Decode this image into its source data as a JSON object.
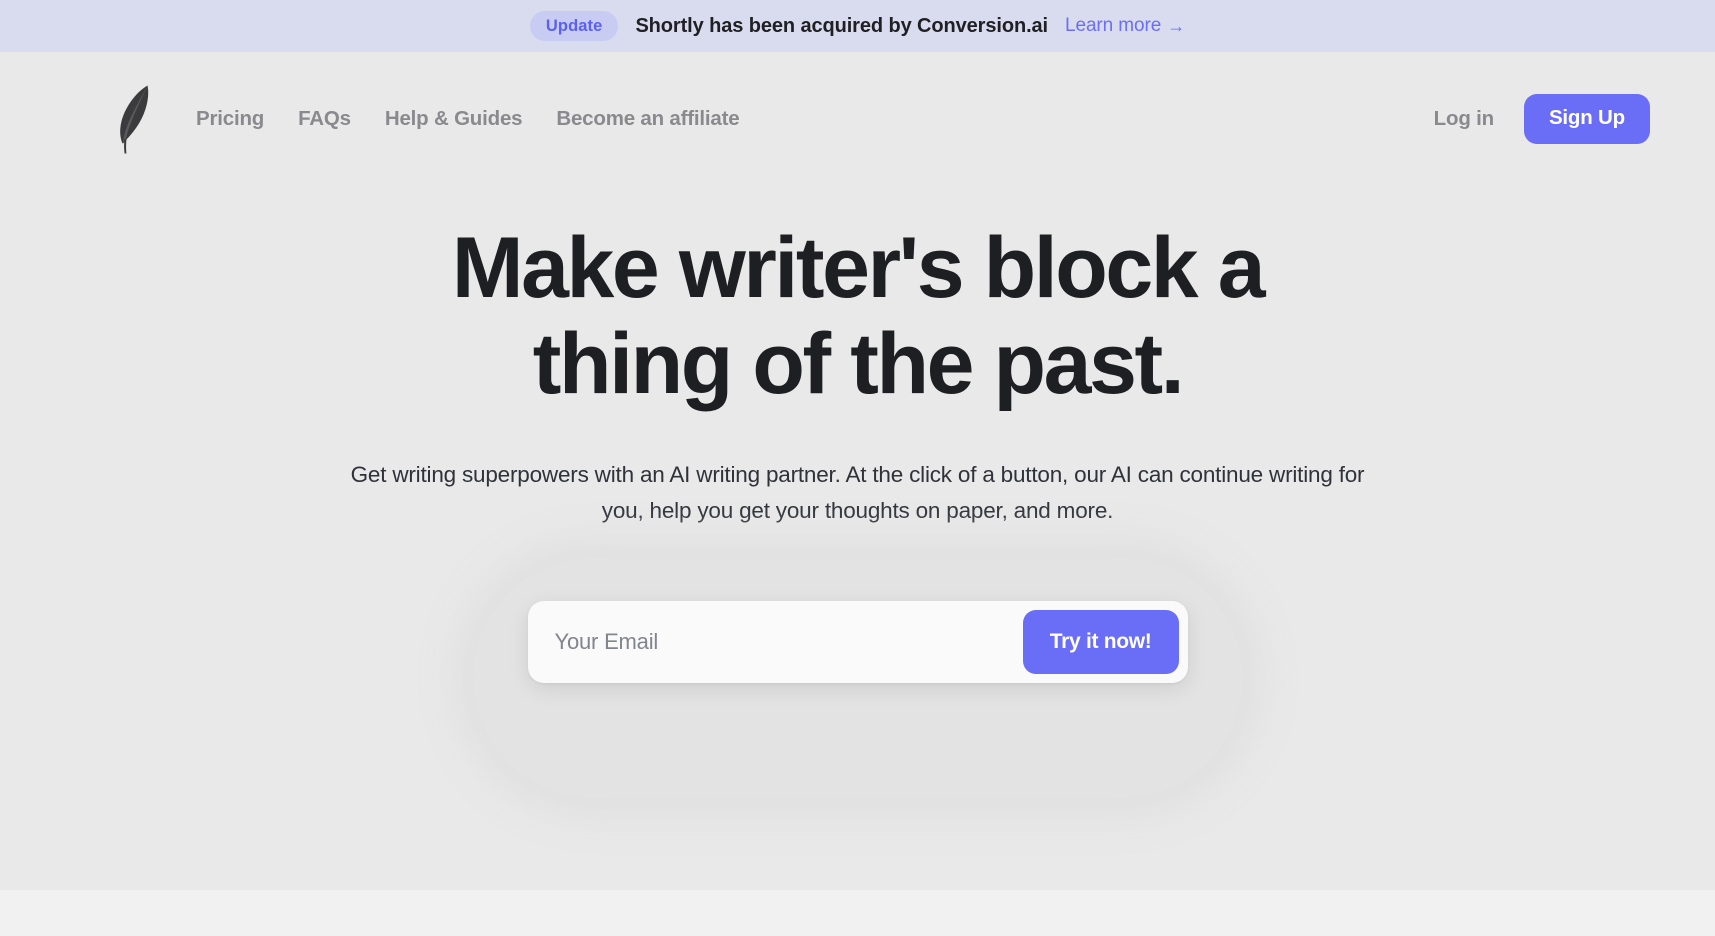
{
  "announcement": {
    "badge_label": "Update",
    "message": "Shortly has been acquired by Conversion.ai",
    "link_label": "Learn more",
    "link_arrow": "→",
    "badge_bg": "#c9ccf2",
    "badge_color": "#5b60f0",
    "bar_bg": "#d9dbee",
    "link_color": "#6b6ef6"
  },
  "nav": {
    "logo_name": "feather-quill-logo",
    "links": [
      {
        "label": "Pricing"
      },
      {
        "label": "FAQs"
      },
      {
        "label": "Help & Guides"
      },
      {
        "label": "Become an affiliate"
      }
    ],
    "login_label": "Log in",
    "signup_label": "Sign Up",
    "accent_color": "#6a6df5",
    "link_color": "#8a8a8e"
  },
  "hero": {
    "headline_line_1": "Make writer's block a",
    "headline_line_2": "thing of the past.",
    "subheadline": "Get writing superpowers with an AI writing partner. At the click of a button, our AI can continue writing for you, help you get your thoughts on paper, and more.",
    "background_color": "#e9e9e9",
    "headline_color": "#1e1f23"
  },
  "signup_form": {
    "email_placeholder": "Your Email",
    "email_value": "",
    "submit_label": "Try it now!",
    "submit_color": "#6a6df5"
  }
}
